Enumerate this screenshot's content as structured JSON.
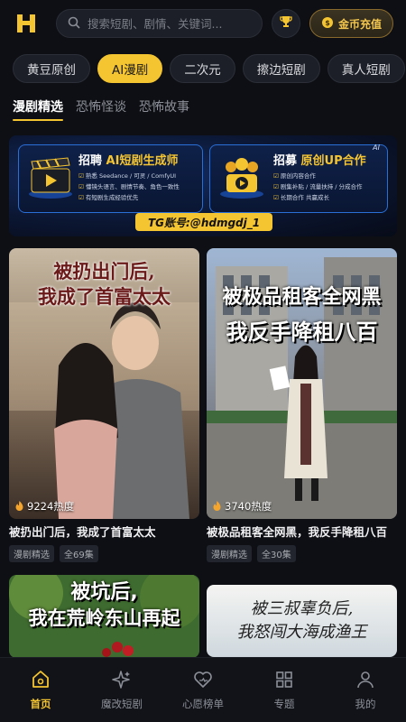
{
  "header": {
    "logo_icon": "h-logo-icon",
    "search_placeholder": "搜索短剧、剧情、关键词...",
    "trophy_icon": "trophy-icon",
    "recharge_label": "金币充值",
    "coin_icon": "coin-icon"
  },
  "categories": [
    {
      "label": "黄豆原创",
      "active": false
    },
    {
      "label": "AI漫剧",
      "active": true
    },
    {
      "label": "二次元",
      "active": false
    },
    {
      "label": "擦边短剧",
      "active": false
    },
    {
      "label": "真人短剧",
      "active": false
    }
  ],
  "subtabs": [
    {
      "label": "漫剧精选",
      "active": true
    },
    {
      "label": "恐怖怪谈",
      "active": false
    },
    {
      "label": "恐怖故事",
      "active": false
    }
  ],
  "banner": {
    "left": {
      "title_prefix": "招聘",
      "title_highlight": "AI短剧生成师",
      "lines": [
        "熟悉 Seedance / 可灵 / ComfyUI",
        "懂镜头语言、剧情节奏、角色一致性",
        "有短剧生成经验优先"
      ]
    },
    "right": {
      "title_prefix": "招募",
      "title_highlight": "原创UP合作",
      "lines": [
        "原创内容合作",
        "剧集补贴 / 流量扶持 / 分成合作",
        "长期合作 共赢成长"
      ],
      "tag": "AI"
    },
    "tg_label": "TG账号:@hdmgdj_1"
  },
  "cards": [
    {
      "poster_text_1": "被扔出门后,",
      "poster_text_2": "我成了首富太太",
      "heat": "9224热度",
      "title": "被扔出门后，我成了首富太太",
      "tags": [
        "漫剧精选",
        "全69集"
      ]
    },
    {
      "poster_text_1": "被极品租客全网黑",
      "poster_text_2": "我反手降租八百",
      "heat": "3740热度",
      "title": "被极品租客全网黑，我反手降租八百",
      "tags": [
        "漫剧精选",
        "全30集"
      ]
    },
    {
      "poster_text_1": "被坑后,",
      "poster_text_2": "我在荒岭东山再起"
    },
    {
      "poster_text_1": "被三叔辜负后,",
      "poster_text_2": "我怒闯大海成渔王"
    }
  ],
  "nav": [
    {
      "label": "首页",
      "icon": "home-icon",
      "active": true
    },
    {
      "label": "魔改短剧",
      "icon": "sparkle-icon",
      "active": false
    },
    {
      "label": "心愿榜单",
      "icon": "heart-icon",
      "active": false
    },
    {
      "label": "专题",
      "icon": "grid-icon",
      "active": false
    },
    {
      "label": "我的",
      "icon": "user-icon",
      "active": false
    }
  ],
  "colors": {
    "accent": "#f4c431",
    "background": "#0d0f14"
  }
}
